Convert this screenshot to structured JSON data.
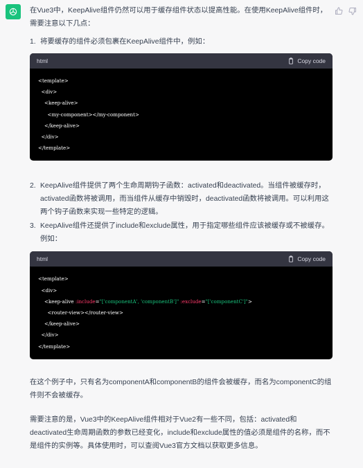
{
  "avatar": {
    "icon": "openai-logo-icon"
  },
  "actions": {
    "thumb_up": "thumbs-up-icon",
    "thumb_down": "thumbs-down-icon"
  },
  "intro": "在Vue3中，KeepAlive组件仍然可以用于缓存组件状态以提高性能。在使用KeepAlive组件时，需要注意以下几点：",
  "list": [
    {
      "num": "1.",
      "text": "将要缓存的组件必须包裹在KeepAlive组件中，例如："
    },
    {
      "num": "2.",
      "text": "KeepAlive组件提供了两个生命周期钩子函数：activated和deactivated。当组件被缓存时，activated函数将被调用，而当组件从缓存中销毁时，deactivated函数将被调用。可以利用这两个钩子函数来实现一些特定的逻辑。"
    },
    {
      "num": "3.",
      "text": "KeepAlive组件还提供了include和exclude属性，用于指定哪些组件应该被缓存或不被缓存。例如："
    }
  ],
  "code_blocks": [
    {
      "lang": "html",
      "copy_label": "Copy code",
      "lines": [
        "<template>",
        "  <div>",
        "    <keep-alive>",
        "      <my-component></my-component>",
        "    </keep-alive>",
        "  </div>",
        "</template>"
      ]
    },
    {
      "lang": "html",
      "copy_label": "Copy code",
      "line1": "<template>",
      "line2": "  <div>",
      "line3_tag": "    <keep-alive ",
      "line3_attr1": ":include",
      "line3_eq1": "=",
      "line3_val1": "\"['componentA', 'componentB']\"",
      "line3_attr2": ":exclude",
      "line3_eq2": "=",
      "line3_val2": "\"['componentC']\"",
      "line3_end": ">",
      "line4": "      <router-view></router-view>",
      "line5": "    </keep-alive>",
      "line6": "  </div>",
      "line7": "</template>"
    }
  ],
  "after_example": "在这个例子中，只有名为componentA和componentB的组件会被缓存，而名为componentC的组件则不会被缓存。",
  "final": "需要注意的是，Vue3中的KeepAlive组件相对于Vue2有一些不同，包括：activated和deactivated生命周期函数的参数已经变化，include和exclude属性的值必须是组件的名称，而不是组件的实例等。具体使用时，可以查阅Vue3官方文档以获取更多信息。",
  "colors": {
    "avatar_bg": "#19c37d",
    "code_bg": "#000000",
    "code_header_bg": "#343541",
    "attr": "#ff3a6b",
    "string": "#19c37d"
  }
}
